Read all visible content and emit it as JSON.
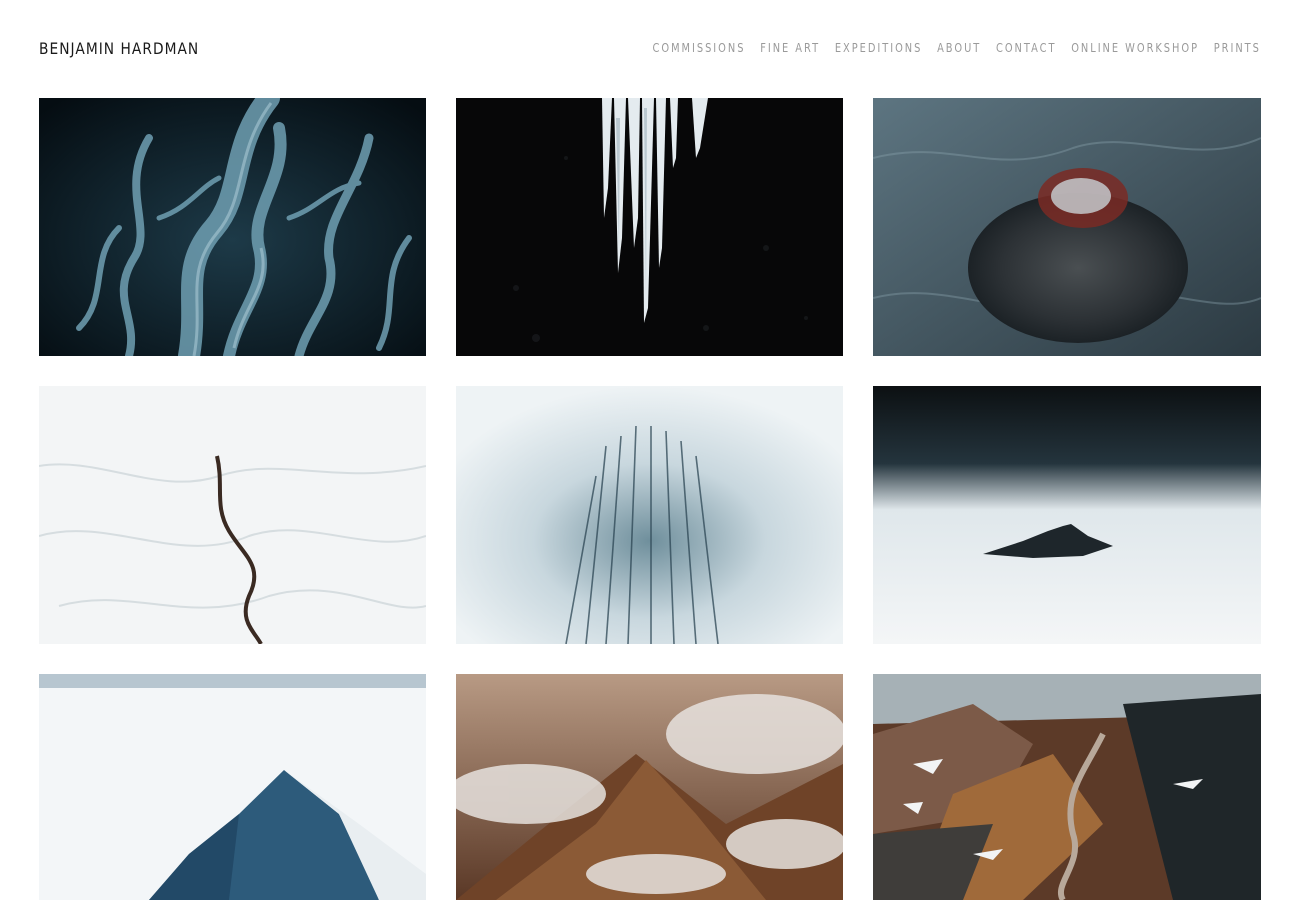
{
  "brand": {
    "name": "BENJAMIN HARDMAN"
  },
  "nav": {
    "items": [
      {
        "label": "COMMISSIONS"
      },
      {
        "label": "FINE ART"
      },
      {
        "label": "EXPEDITIONS"
      },
      {
        "label": "ABOUT"
      },
      {
        "label": "CONTACT"
      },
      {
        "label": "ONLINE WORKSHOP"
      },
      {
        "label": "PRINTS"
      }
    ]
  },
  "gallery": {
    "photos": [
      {
        "subject": "aerial braided glacial river",
        "palette": [
          "#0a1820",
          "#5f8ea0"
        ]
      },
      {
        "subject": "icicles against black",
        "palette": [
          "#070708",
          "#e8eef2"
        ]
      },
      {
        "subject": "aerial volcanic crater",
        "palette": [
          "#3a4d58",
          "#7a2a24"
        ]
      },
      {
        "subject": "snowy valley with dark river",
        "palette": [
          "#f2f4f5",
          "#3a2a22"
        ]
      },
      {
        "subject": "frosted trees in fog",
        "palette": [
          "#e4edf1",
          "#3c5f70"
        ]
      },
      {
        "subject": "peak above sea of fog",
        "palette": [
          "#101416",
          "#eef2f4"
        ]
      },
      {
        "subject": "blue ice ridge in snow",
        "palette": [
          "#f3f6f8",
          "#2c5a7a"
        ]
      },
      {
        "subject": "brown mountains with steam",
        "palette": [
          "#8a5a3a",
          "#d8d4cf"
        ]
      },
      {
        "subject": "colorful rhyolite mountains",
        "palette": [
          "#7a4a30",
          "#2a3438"
        ]
      }
    ]
  }
}
